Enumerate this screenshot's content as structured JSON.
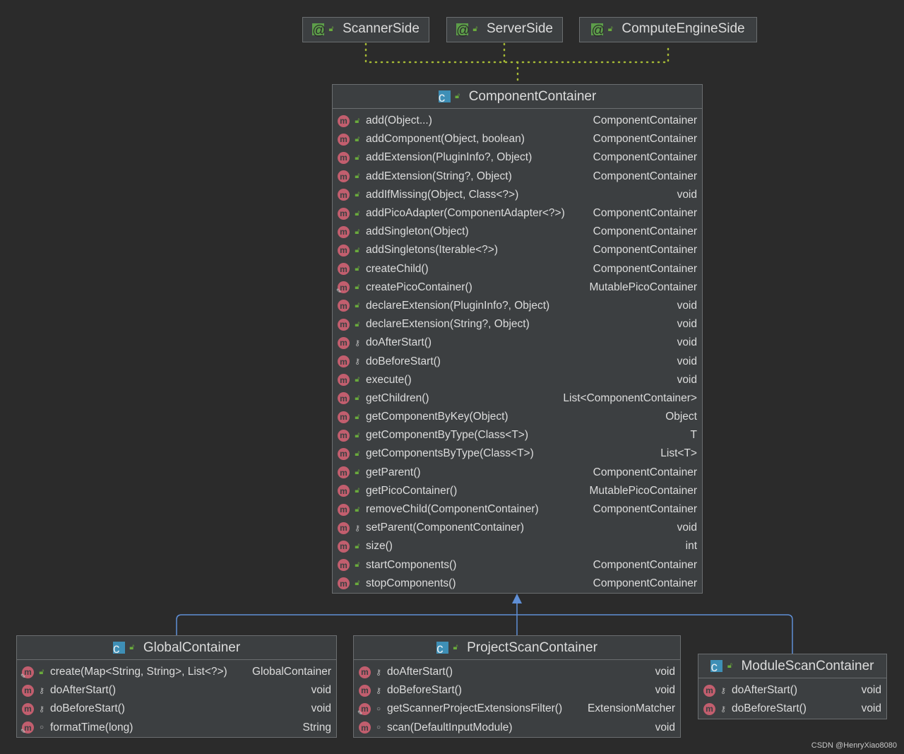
{
  "annotations": [
    {
      "name": "ScannerSide"
    },
    {
      "name": "ServerSide"
    },
    {
      "name": "ComputeEngineSide"
    }
  ],
  "classes": {
    "component_container": {
      "name": "ComponentContainer",
      "methods": [
        {
          "name": "add(Object...)",
          "type": "ComponentContainer",
          "vis": "public"
        },
        {
          "name": "addComponent(Object, boolean)",
          "type": "ComponentContainer",
          "vis": "public"
        },
        {
          "name": "addExtension(PluginInfo?, Object)",
          "type": "ComponentContainer",
          "vis": "public"
        },
        {
          "name": "addExtension(String?, Object)",
          "type": "ComponentContainer",
          "vis": "public"
        },
        {
          "name": "addIfMissing(Object, Class<?>)",
          "type": "void",
          "vis": "public"
        },
        {
          "name": "addPicoAdapter(ComponentAdapter<?>)",
          "type": "ComponentContainer",
          "vis": "public"
        },
        {
          "name": "addSingleton(Object)",
          "type": "ComponentContainer",
          "vis": "public"
        },
        {
          "name": "addSingletons(Iterable<?>)",
          "type": "ComponentContainer",
          "vis": "public"
        },
        {
          "name": "createChild()",
          "type": "ComponentContainer",
          "vis": "public"
        },
        {
          "name": "createPicoContainer()",
          "type": "MutablePicoContainer",
          "vis": "public",
          "static": true
        },
        {
          "name": "declareExtension(PluginInfo?, Object)",
          "type": "void",
          "vis": "public"
        },
        {
          "name": "declareExtension(String?, Object)",
          "type": "void",
          "vis": "public"
        },
        {
          "name": "doAfterStart()",
          "type": "void",
          "vis": "protected"
        },
        {
          "name": "doBeforeStart()",
          "type": "void",
          "vis": "protected"
        },
        {
          "name": "execute()",
          "type": "void",
          "vis": "public"
        },
        {
          "name": "getChildren()",
          "type": "List<ComponentContainer>",
          "vis": "public"
        },
        {
          "name": "getComponentByKey(Object)",
          "type": "Object",
          "vis": "public"
        },
        {
          "name": "getComponentByType(Class<T>)",
          "type": "T",
          "vis": "public"
        },
        {
          "name": "getComponentsByType(Class<T>)",
          "type": "List<T>",
          "vis": "public"
        },
        {
          "name": "getParent()",
          "type": "ComponentContainer",
          "vis": "public"
        },
        {
          "name": "getPicoContainer()",
          "type": "MutablePicoContainer",
          "vis": "public"
        },
        {
          "name": "removeChild(ComponentContainer)",
          "type": "ComponentContainer",
          "vis": "public"
        },
        {
          "name": "setParent(ComponentContainer)",
          "type": "void",
          "vis": "protected"
        },
        {
          "name": "size()",
          "type": "int",
          "vis": "public"
        },
        {
          "name": "startComponents()",
          "type": "ComponentContainer",
          "vis": "public"
        },
        {
          "name": "stopComponents()",
          "type": "ComponentContainer",
          "vis": "public"
        }
      ]
    },
    "global_container": {
      "name": "GlobalContainer",
      "methods": [
        {
          "name": "create(Map<String, String>, List<?>)",
          "type": "GlobalContainer",
          "vis": "public",
          "static": true
        },
        {
          "name": "doAfterStart()",
          "type": "void",
          "vis": "protected"
        },
        {
          "name": "doBeforeStart()",
          "type": "void",
          "vis": "protected"
        },
        {
          "name": "formatTime(long)",
          "type": "String",
          "vis": "package",
          "static": true
        }
      ]
    },
    "project_scan_container": {
      "name": "ProjectScanContainer",
      "methods": [
        {
          "name": "doAfterStart()",
          "type": "void",
          "vis": "protected"
        },
        {
          "name": "doBeforeStart()",
          "type": "void",
          "vis": "protected"
        },
        {
          "name": "getScannerProjectExtensionsFilter()",
          "type": "ExtensionMatcher",
          "vis": "package",
          "static": true
        },
        {
          "name": "scan(DefaultInputModule)",
          "type": "void",
          "vis": "package"
        }
      ]
    },
    "module_scan_container": {
      "name": "ModuleScanContainer",
      "methods": [
        {
          "name": "doAfterStart()",
          "type": "void",
          "vis": "protected"
        },
        {
          "name": "doBeforeStart()",
          "type": "void",
          "vis": "protected"
        }
      ]
    }
  },
  "watermark": "CSDN @HenryXiao8080",
  "colors": {
    "background": "#2b2b2b",
    "box": "#3c3f41",
    "method_icon": "#c25e6e",
    "class_icon": "#3e8fb6",
    "annotation_icon": "#5d9e4a",
    "dotted_edge": "#a5b935",
    "inherit_edge": "#5f8fd6"
  }
}
